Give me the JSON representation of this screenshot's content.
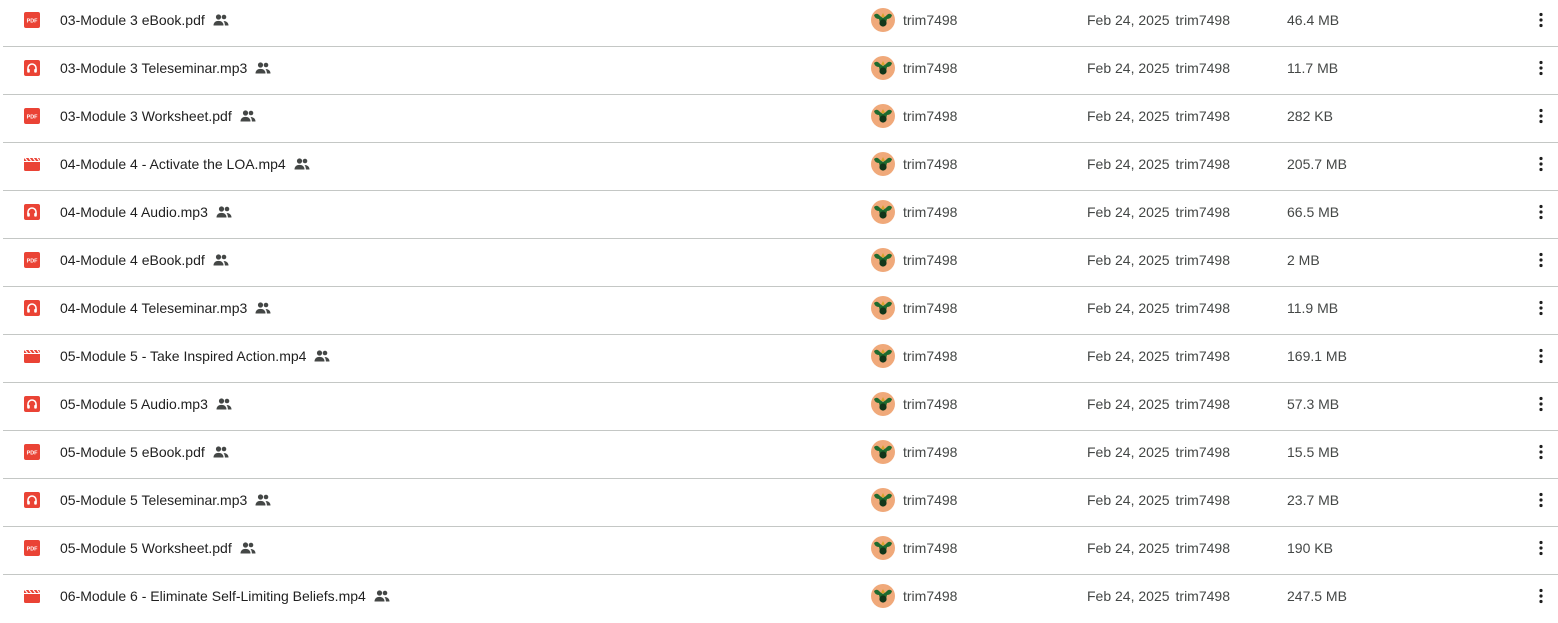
{
  "theme": {
    "pdf_color": "#ea4335",
    "audio_color": "#ea4335",
    "video_color": "#ea4335",
    "text_color": "#1f1f1f",
    "secondary_text": "#444746",
    "divider": "#c4c7c5"
  },
  "files": [
    {
      "name": "03-Module 3 eBook.pdf",
      "type": "pdf-icon",
      "owner": "trim7498",
      "modified_date": "Feb 24, 2025",
      "modified_by": "trim7498",
      "size": "46.4 MB"
    },
    {
      "name": "03-Module 3 Teleseminar.mp3",
      "type": "audio-icon",
      "owner": "trim7498",
      "modified_date": "Feb 24, 2025",
      "modified_by": "trim7498",
      "size": "11.7 MB"
    },
    {
      "name": "03-Module 3 Worksheet.pdf",
      "type": "pdf-icon",
      "owner": "trim7498",
      "modified_date": "Feb 24, 2025",
      "modified_by": "trim7498",
      "size": "282 KB"
    },
    {
      "name": "04-Module 4 - Activate the LOA.mp4",
      "type": "video-icon",
      "owner": "trim7498",
      "modified_date": "Feb 24, 2025",
      "modified_by": "trim7498",
      "size": "205.7 MB"
    },
    {
      "name": "04-Module 4 Audio.mp3",
      "type": "audio-icon",
      "owner": "trim7498",
      "modified_date": "Feb 24, 2025",
      "modified_by": "trim7498",
      "size": "66.5 MB"
    },
    {
      "name": "04-Module 4 eBook.pdf",
      "type": "pdf-icon",
      "owner": "trim7498",
      "modified_date": "Feb 24, 2025",
      "modified_by": "trim7498",
      "size": "2 MB"
    },
    {
      "name": "04-Module 4 Teleseminar.mp3",
      "type": "audio-icon",
      "owner": "trim7498",
      "modified_date": "Feb 24, 2025",
      "modified_by": "trim7498",
      "size": "11.9 MB"
    },
    {
      "name": "05-Module 5 - Take Inspired Action.mp4",
      "type": "video-icon",
      "owner": "trim7498",
      "modified_date": "Feb 24, 2025",
      "modified_by": "trim7498",
      "size": "169.1 MB"
    },
    {
      "name": "05-Module 5 Audio.mp3",
      "type": "audio-icon",
      "owner": "trim7498",
      "modified_date": "Feb 24, 2025",
      "modified_by": "trim7498",
      "size": "57.3 MB"
    },
    {
      "name": "05-Module 5 eBook.pdf",
      "type": "pdf-icon",
      "owner": "trim7498",
      "modified_date": "Feb 24, 2025",
      "modified_by": "trim7498",
      "size": "15.5 MB"
    },
    {
      "name": "05-Module 5 Teleseminar.mp3",
      "type": "audio-icon",
      "owner": "trim7498",
      "modified_date": "Feb 24, 2025",
      "modified_by": "trim7498",
      "size": "23.7 MB"
    },
    {
      "name": "05-Module 5 Worksheet.pdf",
      "type": "pdf-icon",
      "owner": "trim7498",
      "modified_date": "Feb 24, 2025",
      "modified_by": "trim7498",
      "size": "190 KB"
    },
    {
      "name": "06-Module 6 - Eliminate Self-Limiting Beliefs.mp4",
      "type": "video-icon",
      "owner": "trim7498",
      "modified_date": "Feb 24, 2025",
      "modified_by": "trim7498",
      "size": "247.5 MB"
    }
  ]
}
